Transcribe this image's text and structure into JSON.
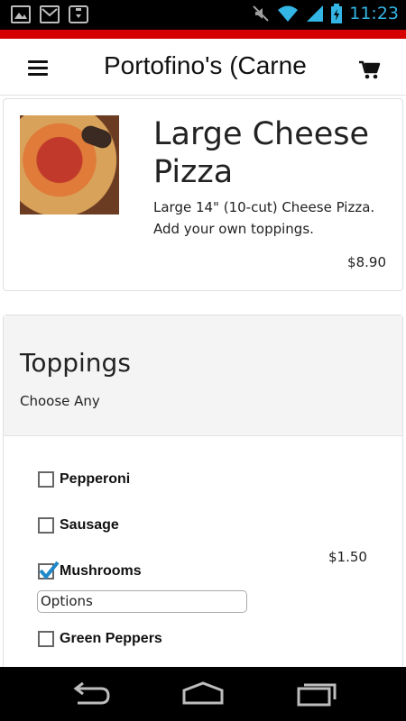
{
  "status": {
    "time": "11:23",
    "left_icons": [
      "image-icon",
      "gmail-icon",
      "briefcase-icon"
    ],
    "right_icons": [
      "mute-icon",
      "wifi-icon",
      "signal-icon",
      "battery-icon"
    ]
  },
  "appbar": {
    "title": "Portofino's (Carne",
    "accent_color": "#d50000"
  },
  "item": {
    "title": "Large Cheese Pizza",
    "description": "Large 14\" (10-cut) Cheese Pizza. Add your own toppings.",
    "price": "$8.90"
  },
  "toppings": {
    "title": "Toppings",
    "subtitle": "Choose Any",
    "options": [
      {
        "label": "Pepperoni",
        "checked": false,
        "price": ""
      },
      {
        "label": "Sausage",
        "checked": false,
        "price": ""
      },
      {
        "label": "Mushrooms",
        "checked": true,
        "price": "$1.50"
      },
      {
        "label": "Green Peppers",
        "checked": false,
        "price": ""
      }
    ],
    "options_select": "Options"
  },
  "navbar": {
    "icons": [
      "back-icon",
      "home-icon",
      "recents-icon"
    ]
  }
}
